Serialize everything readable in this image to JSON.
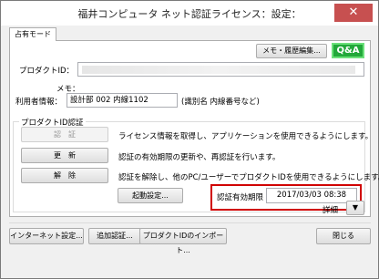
{
  "window": {
    "title": "福井コンピュータ ネット認証ライセンス：設定：",
    "close_glyph": "✕"
  },
  "tab": {
    "label": "占有モード"
  },
  "header": {
    "memo_history_button": "メモ・履歴編集...",
    "qa_button": "Q&A"
  },
  "product_id": {
    "label": "プロダクトID："
  },
  "memo": {
    "label": "メモ："
  },
  "user_info": {
    "label": "利用者情報：",
    "value": "設計部 002  内線1102",
    "hint": "(識別名 内線番号など)"
  },
  "product_group": {
    "title": "プロダクトID認証",
    "actions": [
      {
        "button": "認　証",
        "description": "ライセンス情報を取得し、アプリケーションを使用できるようにします。",
        "enabled": false
      },
      {
        "button": "更　新",
        "description": "認証の有効期限の更新や、再認証を行います。",
        "enabled": true
      },
      {
        "button": "解　除",
        "description": "認証を解除し、他のPC/ユーザーでプロダクトIDを使用できるようにします。",
        "enabled": true
      }
    ],
    "startup_settings_button": "起動設定...",
    "expiry_label": "認証有効期限",
    "expiry_value": "2017/03/03 08:38"
  },
  "detail": {
    "label": "詳細",
    "arrow": "▼"
  },
  "footer": {
    "internet_settings": "インターネット設定...",
    "add_auth": "追加認証...",
    "import_product_id": "プロダクトIDのインポート...",
    "close": "閉じる"
  }
}
